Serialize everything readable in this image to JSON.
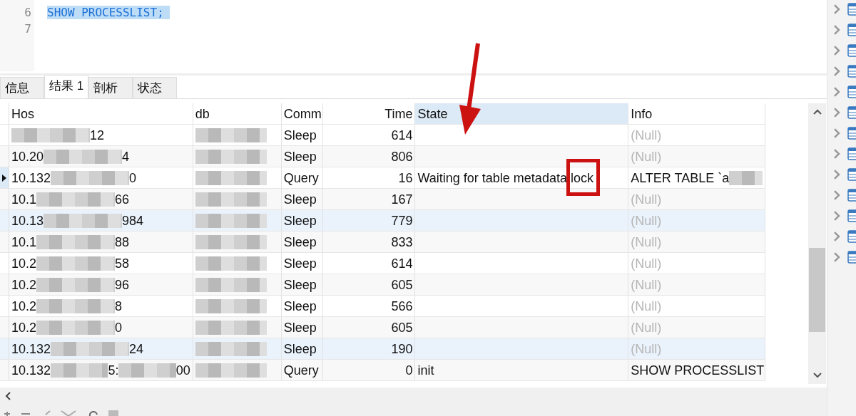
{
  "editor": {
    "lines": [
      {
        "number": "6",
        "code": "SHOW PROCESSLIST;",
        "selected": true
      },
      {
        "number": "7"
      }
    ]
  },
  "tabs": [
    {
      "label": "信息",
      "selected": false
    },
    {
      "label": "结果 1",
      "selected": true
    },
    {
      "label": "剖析",
      "selected": false
    },
    {
      "label": "状态",
      "selected": false
    }
  ],
  "table": {
    "columns": [
      {
        "label": "Hos",
        "sorted": false
      },
      {
        "label": "db",
        "sorted": false
      },
      {
        "label": "Comm",
        "sorted": false
      },
      {
        "label": "Time",
        "sorted": false
      },
      {
        "label": "State",
        "sorted": true
      },
      {
        "label": "Info",
        "sorted": false
      }
    ],
    "rows": [
      {
        "current": false,
        "highlighted": false,
        "host": [
          {
            "kind": "blur"
          },
          {
            "kind": "text",
            "text": "12"
          }
        ],
        "db": [
          {
            "kind": "blur"
          }
        ],
        "command": "Sleep",
        "time": "614",
        "state": "",
        "info": {
          "kind": "null",
          "text": "(Null)"
        }
      },
      {
        "current": false,
        "highlighted": false,
        "host": [
          {
            "kind": "text",
            "text": "10.20"
          },
          {
            "kind": "blur"
          },
          {
            "kind": "text",
            "text": "4"
          }
        ],
        "db": [
          {
            "kind": "blur"
          }
        ],
        "command": "Sleep",
        "time": "806",
        "state": "",
        "info": {
          "kind": "null",
          "text": "(Null)"
        }
      },
      {
        "current": true,
        "highlighted": false,
        "host": [
          {
            "kind": "text",
            "text": "10.132"
          },
          {
            "kind": "blur"
          },
          {
            "kind": "text",
            "text": "0"
          }
        ],
        "db": [
          {
            "kind": "blur"
          }
        ],
        "command": "Query",
        "time": "16",
        "state": "Waiting for table metadata lock",
        "info": {
          "kind": "text",
          "text": "ALTER TABLE `a",
          "blurred": true
        }
      },
      {
        "current": false,
        "highlighted": false,
        "host": [
          {
            "kind": "text",
            "text": "10.1"
          },
          {
            "kind": "blur"
          },
          {
            "kind": "text",
            "text": "66"
          }
        ],
        "db": [
          {
            "kind": "blur"
          }
        ],
        "command": "Sleep",
        "time": "167",
        "state": "",
        "info": {
          "kind": "null",
          "text": "(Null)"
        }
      },
      {
        "current": false,
        "highlighted": true,
        "host": [
          {
            "kind": "text",
            "text": "10.13"
          },
          {
            "kind": "blur"
          },
          {
            "kind": "text",
            "text": "984"
          }
        ],
        "db": [
          {
            "kind": "blur"
          }
        ],
        "command": "Sleep",
        "time": "779",
        "state": "",
        "info": {
          "kind": "null",
          "text": "(Null)"
        }
      },
      {
        "current": false,
        "highlighted": false,
        "host": [
          {
            "kind": "text",
            "text": "10.1"
          },
          {
            "kind": "blur"
          },
          {
            "kind": "text",
            "text": "88"
          }
        ],
        "db": [
          {
            "kind": "blur"
          }
        ],
        "command": "Sleep",
        "time": "833",
        "state": "",
        "info": {
          "kind": "null",
          "text": "(Null)"
        }
      },
      {
        "current": false,
        "highlighted": false,
        "host": [
          {
            "kind": "text",
            "text": "10.2"
          },
          {
            "kind": "blur"
          },
          {
            "kind": "text",
            "text": "58"
          }
        ],
        "db": [
          {
            "kind": "blur"
          }
        ],
        "command": "Sleep",
        "time": "614",
        "state": "",
        "info": {
          "kind": "null",
          "text": "(Null)"
        }
      },
      {
        "current": false,
        "highlighted": false,
        "host": [
          {
            "kind": "text",
            "text": "10.2"
          },
          {
            "kind": "blur"
          },
          {
            "kind": "text",
            "text": "96"
          }
        ],
        "db": [
          {
            "kind": "blur"
          }
        ],
        "command": "Sleep",
        "time": "605",
        "state": "",
        "info": {
          "kind": "null",
          "text": "(Null)"
        }
      },
      {
        "current": false,
        "highlighted": false,
        "host": [
          {
            "kind": "text",
            "text": "10.2"
          },
          {
            "kind": "blur"
          },
          {
            "kind": "text",
            "text": "8"
          }
        ],
        "db": [
          {
            "kind": "blur"
          }
        ],
        "command": "Sleep",
        "time": "566",
        "state": "",
        "info": {
          "kind": "null",
          "text": "(Null)"
        }
      },
      {
        "current": false,
        "highlighted": false,
        "host": [
          {
            "kind": "text",
            "text": "10.2"
          },
          {
            "kind": "blur"
          },
          {
            "kind": "text",
            "text": "0"
          }
        ],
        "db": [
          {
            "kind": "blur"
          }
        ],
        "command": "Sleep",
        "time": "605",
        "state": "",
        "info": {
          "kind": "null",
          "text": "(Null)"
        }
      },
      {
        "current": false,
        "highlighted": true,
        "host": [
          {
            "kind": "text",
            "text": "10.132"
          },
          {
            "kind": "blur"
          },
          {
            "kind": "text",
            "text": "24"
          }
        ],
        "db": [
          {
            "kind": "blur"
          }
        ],
        "command": "Sleep",
        "time": "190",
        "state": "",
        "info": {
          "kind": "null",
          "text": "(Null)"
        }
      },
      {
        "current": false,
        "highlighted": false,
        "host": [
          {
            "kind": "text",
            "text": "10.132"
          },
          {
            "kind": "blur"
          },
          {
            "kind": "text",
            "text": "5:"
          },
          {
            "kind": "blur"
          },
          {
            "kind": "text",
            "text": "00"
          }
        ],
        "db": [
          {
            "kind": "blur"
          }
        ],
        "command": "Query",
        "time": "0",
        "state": "init",
        "info": {
          "kind": "text",
          "text": "SHOW PROCESSLIST"
        }
      }
    ]
  },
  "annotations": {
    "arrow": true,
    "box": true
  },
  "tree": {
    "items": [
      {
        "kind": "table"
      },
      {
        "kind": "table"
      },
      {
        "kind": "table"
      },
      {
        "kind": "table"
      },
      {
        "kind": "table"
      },
      {
        "kind": "table"
      },
      {
        "kind": "table"
      },
      {
        "kind": "table"
      },
      {
        "kind": "table"
      },
      {
        "kind": "table"
      },
      {
        "kind": "table"
      },
      {
        "kind": "table"
      },
      {
        "kind": "table"
      }
    ]
  }
}
